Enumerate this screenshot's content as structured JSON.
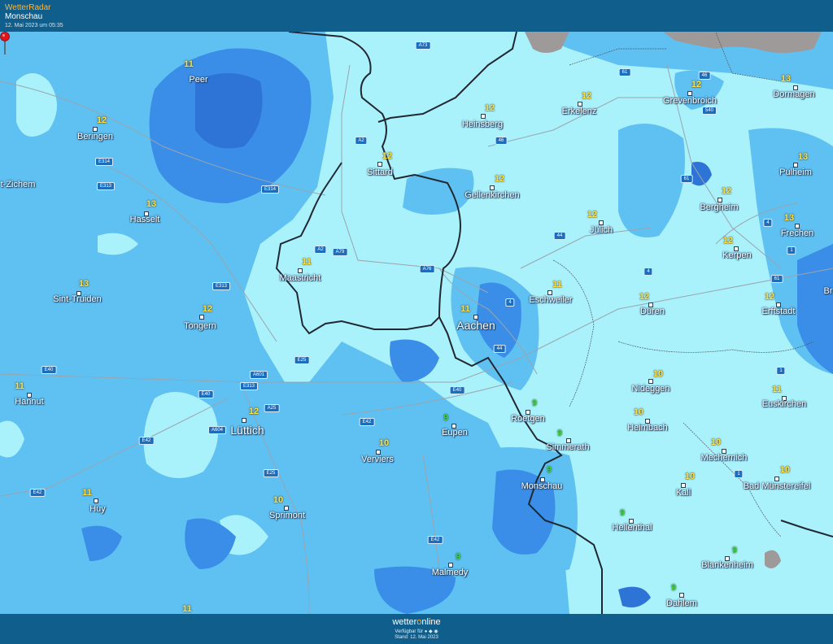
{
  "header": {
    "app_name": "WetterRadar",
    "location": "Monschau",
    "timestamp": "12. Mai 2023 um 05:35"
  },
  "footer": {
    "brand_prefix": "wetter",
    "brand_o": "o",
    "brand_suffix": "nline",
    "availability": "Verfügbar für ● ◆ ◉",
    "stand": "Stand: 12. Mai 2023"
  },
  "colors": {
    "precip_light": "#a9f1fb",
    "precip_medium": "#5fc0f2",
    "precip_dark": "#3a8ee8",
    "precip_darker": "#2d74d6",
    "border_line": "#222831",
    "bar_bg": "#0f5e8c",
    "temp_yellow": "#ffe24a",
    "temp_green": "#3bd13a",
    "marker_red": "#e0141b"
  },
  "cities": [
    {
      "name": "Peer",
      "temp": "11",
      "green": false
    },
    {
      "name": "Beringen",
      "temp": "12",
      "green": false
    },
    {
      "name": "Hasselt",
      "temp": "13",
      "green": false
    },
    {
      "name": "t-Zichem",
      "temp": "",
      "green": false
    },
    {
      "name": "Sint-Truiden",
      "temp": "13",
      "green": false
    },
    {
      "name": "Tongern",
      "temp": "12",
      "green": false
    },
    {
      "name": "Hannut",
      "temp": "11",
      "green": false
    },
    {
      "name": "Huy",
      "temp": "11",
      "green": false
    },
    {
      "name": "Lüttich",
      "temp": "12",
      "green": false
    },
    {
      "name": "Sprimont",
      "temp": "10",
      "green": false
    },
    {
      "name": "Verviers",
      "temp": "10",
      "green": false
    },
    {
      "name": "Maastricht",
      "temp": "11",
      "green": false
    },
    {
      "name": "Sittard",
      "temp": "12",
      "green": false
    },
    {
      "name": "Heinsberg",
      "temp": "12",
      "green": false
    },
    {
      "name": "Gellenkirchen",
      "temp": "12",
      "green": false
    },
    {
      "name": "Erkelenz",
      "temp": "12",
      "green": false
    },
    {
      "name": "Grevenbroich",
      "temp": "12",
      "green": false
    },
    {
      "name": "Dormagen",
      "temp": "13",
      "green": false
    },
    {
      "name": "Pulheim",
      "temp": "13",
      "green": false
    },
    {
      "name": "Bergheim",
      "temp": "12",
      "green": false
    },
    {
      "name": "Frechen",
      "temp": "13",
      "green": false
    },
    {
      "name": "Jülich",
      "temp": "12",
      "green": false
    },
    {
      "name": "Kerpen",
      "temp": "12",
      "green": false
    },
    {
      "name": "Eschweiler",
      "temp": "11",
      "green": false
    },
    {
      "name": "Aachen",
      "temp": "11",
      "green": false
    },
    {
      "name": "Düren",
      "temp": "12",
      "green": false
    },
    {
      "name": "Erftstadt",
      "temp": "12",
      "green": false
    },
    {
      "name": "Nideggen",
      "temp": "10",
      "green": false
    },
    {
      "name": "Heimbach",
      "temp": "10",
      "green": false
    },
    {
      "name": "Euskirchen",
      "temp": "11",
      "green": false
    },
    {
      "name": "Mechernich",
      "temp": "10",
      "green": false
    },
    {
      "name": "Kall",
      "temp": "10",
      "green": false
    },
    {
      "name": "Bad Münstereifel",
      "temp": "10",
      "green": false
    },
    {
      "name": "Roetgen",
      "temp": "9",
      "green": true
    },
    {
      "name": "Eupen",
      "temp": "9",
      "green": true
    },
    {
      "name": "Simmerath",
      "temp": "9",
      "green": true
    },
    {
      "name": "Monschau",
      "temp": "9",
      "green": true
    },
    {
      "name": "Hellenthal",
      "temp": "9",
      "green": true
    },
    {
      "name": "Malmedy",
      "temp": "9",
      "green": true
    },
    {
      "name": "Blankenheim",
      "temp": "9",
      "green": true
    },
    {
      "name": "Dahlem",
      "temp": "9",
      "green": true
    },
    {
      "name": "Br",
      "temp": "",
      "green": false
    },
    {
      "name": "",
      "temp": "11",
      "green": false
    }
  ],
  "roads": [
    "A73",
    "61",
    "46",
    "540",
    "A2",
    "46",
    "E314",
    "E313",
    "E314",
    "61",
    "A2",
    "A79",
    "A76",
    "44",
    "4",
    "E313",
    "4",
    "1",
    "61",
    "4",
    "E25",
    "A601",
    "E313",
    "44",
    "E40",
    "E40",
    "A25",
    "E40",
    "E42",
    "A604",
    "E42",
    "E25",
    "E42",
    "E42",
    "1",
    "1"
  ],
  "marker": {
    "name": "location-marker",
    "place": "Monschau"
  }
}
